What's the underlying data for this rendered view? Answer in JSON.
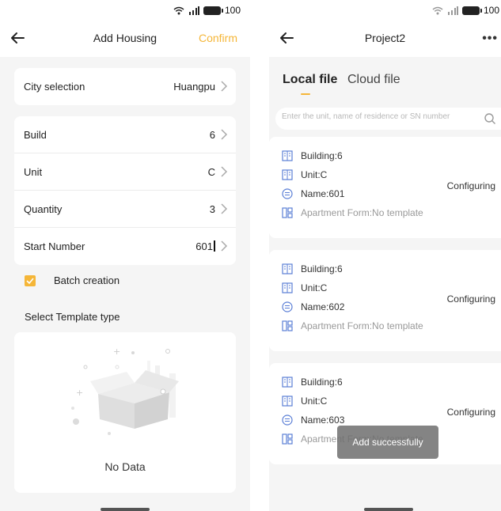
{
  "left": {
    "status_bar": {
      "battery": "100"
    },
    "header": {
      "title": "Add Housing",
      "confirm_label": "Confirm"
    },
    "city": {
      "label": "City selection",
      "value": "Huangpu"
    },
    "fields": [
      {
        "label": "Build",
        "value": "6"
      },
      {
        "label": "Unit",
        "value": "C"
      },
      {
        "label": "Quantity",
        "value": "3"
      },
      {
        "label": "Start Number",
        "value": "601"
      }
    ],
    "batch_creation": {
      "label": "Batch creation",
      "checked": true
    },
    "template_section": {
      "title": "Select Template type"
    },
    "empty_state": {
      "text": "No Data"
    }
  },
  "right": {
    "status_bar": {
      "battery": "100"
    },
    "header": {
      "title": "Project2",
      "more_label": "•••"
    },
    "tabs": [
      {
        "label": "Local file",
        "active": true
      },
      {
        "label": "Cloud file",
        "active": false
      }
    ],
    "search": {
      "placeholder": "Enter the unit, name of residence or SN number"
    },
    "units": [
      {
        "building": "Building:6",
        "unit": "Unit:C",
        "name": "Name:601",
        "form": "Apartment Form:No template",
        "status": "Configuring"
      },
      {
        "building": "Building:6",
        "unit": "Unit:C",
        "name": "Name:602",
        "form": "Apartment Form:No template",
        "status": "Configuring"
      },
      {
        "building": "Building:6",
        "unit": "Unit:C",
        "name": "Name:603",
        "form": "Apartment Form:No template",
        "status": "Configuring"
      }
    ],
    "toast": "Add successfully"
  },
  "colors": {
    "accent": "#f5b638",
    "icon_blue": "#5b7fd6",
    "background": "#f5f5f5"
  },
  "icons": [
    "back-arrow-icon",
    "chevron-right-icon",
    "wifi-icon",
    "signal-icon",
    "battery-icon",
    "more-icon",
    "search-icon",
    "building-icon",
    "unit-icon",
    "name-icon",
    "apartment-form-icon",
    "empty-box-icon",
    "check-icon"
  ]
}
